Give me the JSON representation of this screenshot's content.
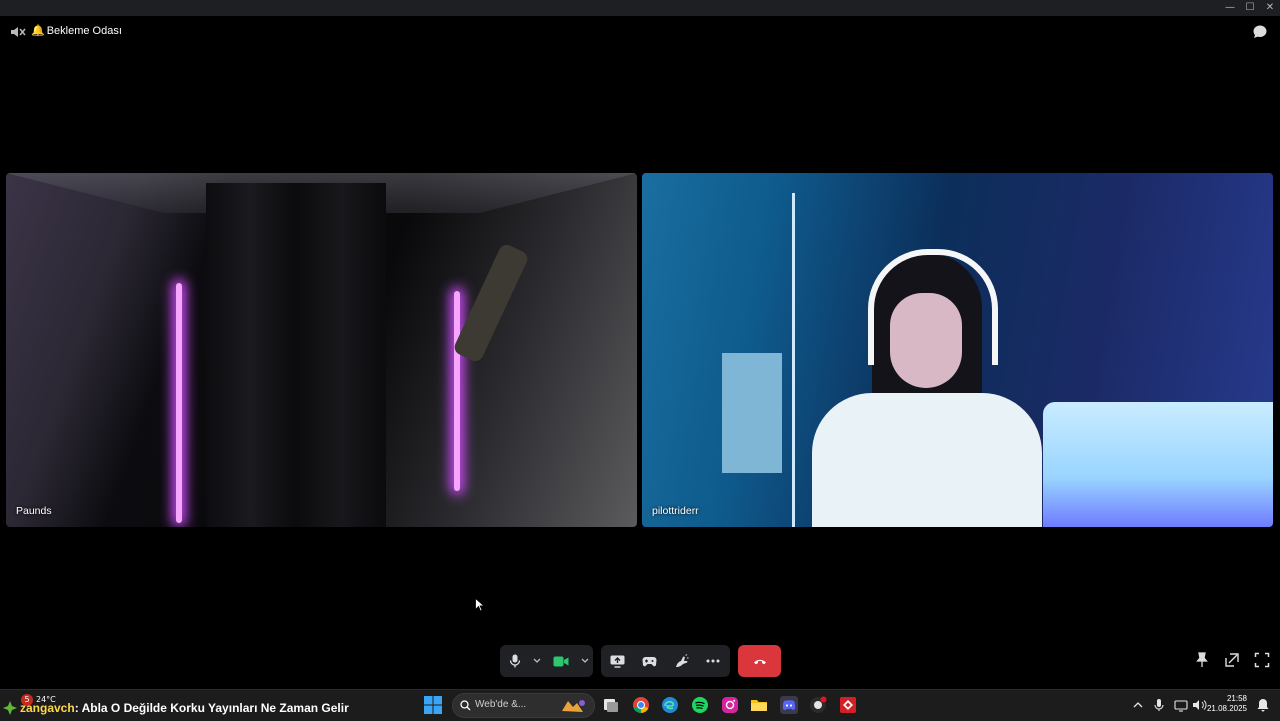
{
  "window": {
    "minimize": "—",
    "maximize": "☐",
    "close": "✕"
  },
  "header": {
    "channel_name": "Bekleme Odası"
  },
  "participants": [
    {
      "name": "Paunds"
    },
    {
      "name": "pilottriderr"
    }
  ],
  "taskbar": {
    "weather_badge": "5",
    "temperature": "24°C",
    "ticker_user": "zangavch",
    "ticker_message": ": Abla O Değilde Korku Yayınları Ne Zaman Gelir",
    "search_placeholder": "Web'de &...",
    "time": "21:58",
    "date": "21.08.2025"
  },
  "colors": {
    "end_call": "#da373c",
    "camera_on": "#2dc770",
    "accent": "#5865f2"
  }
}
